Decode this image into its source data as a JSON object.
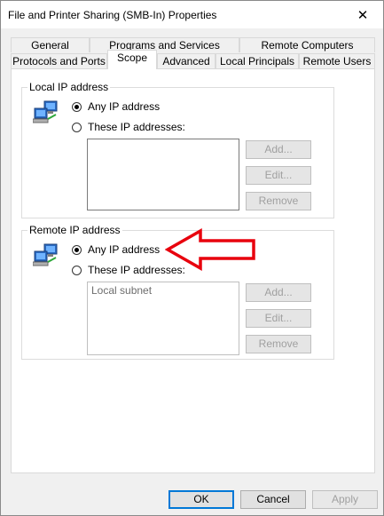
{
  "window": {
    "title": "File and Printer Sharing (SMB-In) Properties",
    "close_glyph": "✕"
  },
  "tabs": {
    "row_back": [
      "General",
      "Programs and Services",
      "Remote Computers"
    ],
    "row_front": [
      "Protocols and Ports",
      "Scope",
      "Advanced",
      "Local Principals",
      "Remote Users"
    ],
    "active": "Scope"
  },
  "local_ip": {
    "group_label": "Local IP address",
    "option_any": "Any IP address",
    "option_these": "These IP addresses:",
    "selected": "any",
    "list_items": [],
    "buttons": {
      "add": "Add...",
      "edit": "Edit...",
      "remove": "Remove"
    }
  },
  "remote_ip": {
    "group_label": "Remote IP address",
    "option_any": "Any IP address",
    "option_these": "These IP addresses:",
    "selected": "any",
    "list_items": [
      "Local subnet"
    ],
    "buttons": {
      "add": "Add...",
      "edit": "Edit...",
      "remove": "Remove"
    }
  },
  "annotation": {
    "arrow_color": "#e8000d",
    "arrow_fill": "#ffffff"
  },
  "footer": {
    "ok": "OK",
    "cancel": "Cancel",
    "apply": "Apply"
  }
}
